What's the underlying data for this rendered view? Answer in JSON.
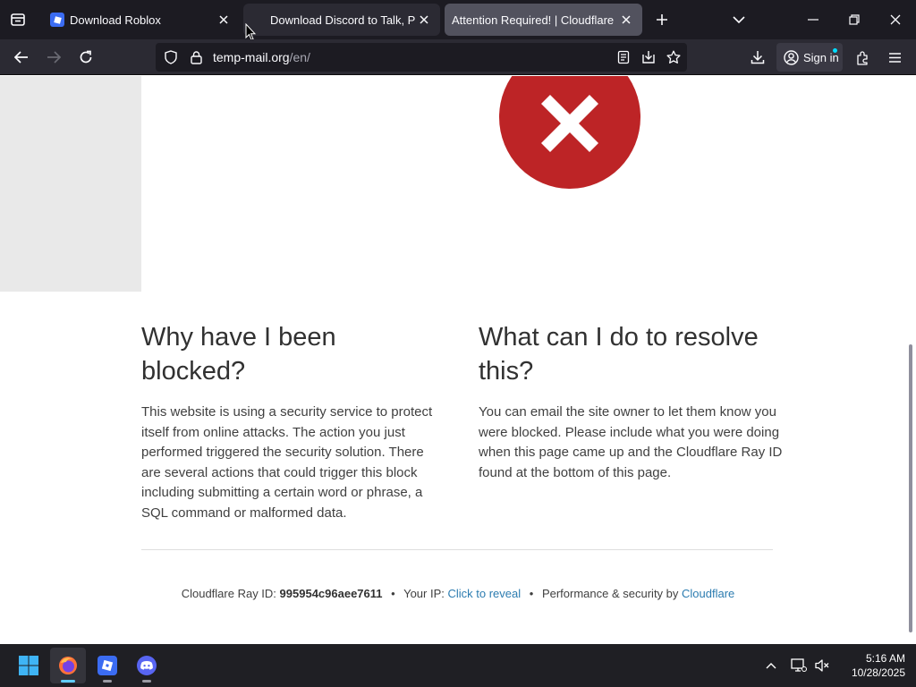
{
  "browser": {
    "tabs": [
      {
        "title": "Download Roblox",
        "icon": "roblox-icon"
      },
      {
        "title": "Download Discord to Talk, Play, and Hang Out",
        "icon": "none"
      },
      {
        "title": "Attention Required! | Cloudflare",
        "icon": "none"
      }
    ],
    "url": {
      "host": "temp-mail.org",
      "path": "/en/"
    },
    "sign_in_label": "Sign in"
  },
  "page": {
    "left_heading": "Why have I been blocked?",
    "left_text": "This website is using a security service to protect itself from online attacks. The action you just performed triggered the security solution. There are several actions that could trigger this block including submitting a certain word or phrase, a SQL command or malformed data.",
    "right_heading": "What can I do to resolve this?",
    "right_text": "You can email the site owner to let them know you were blocked. Please include what you were doing when this page came up and the Cloudflare Ray ID found at the bottom of this page.",
    "footer": {
      "ray_label": "Cloudflare Ray ID:",
      "ray_id": "995954c96aee7611",
      "ip_label": "Your IP:",
      "ip_link": "Click to reveal",
      "perf_label": "Performance & security by",
      "perf_link": "Cloudflare"
    }
  },
  "taskbar": {
    "time": "5:16 AM",
    "date": "10/28/2025"
  },
  "colors": {
    "error_red": "#bd2426",
    "link_blue": "#2c7cb0",
    "tab_active": "#52525e",
    "browser_dark": "#1c1b22"
  }
}
